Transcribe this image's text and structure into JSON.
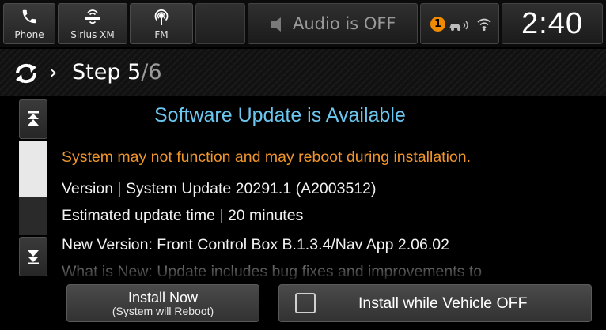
{
  "topbar": {
    "sources": [
      {
        "label": "Phone",
        "icon": "phone-icon"
      },
      {
        "label": "Sirius XM",
        "icon": "siriusxm-icon"
      },
      {
        "label": "FM",
        "icon": "fm-radio-icon"
      }
    ],
    "audio_status": "Audio is OFF",
    "notification_count": "1",
    "clock": "2:40"
  },
  "header": {
    "step_prefix": "Step 5",
    "step_total": "/6"
  },
  "content": {
    "title": "Software Update is Available",
    "warning": "System may not function and may reboot during installation.",
    "version_label": "Version",
    "version_value": "System Update 20291.1 (A2003512)",
    "time_label": "Estimated update time",
    "time_value": "20 minutes",
    "new_version": "New Version:  Front Control Box B.1.3.4/Nav App 2.06.02",
    "whats_new": "What is New: Update includes bug fixes and improvements to"
  },
  "buttons": {
    "install_now": "Install Now",
    "install_now_sub": "(System will Reboot)",
    "install_off": "Install while Vehicle OFF"
  },
  "colors": {
    "title": "#6cc7f0",
    "warning": "#f0942c",
    "badge": "#f08a00"
  }
}
